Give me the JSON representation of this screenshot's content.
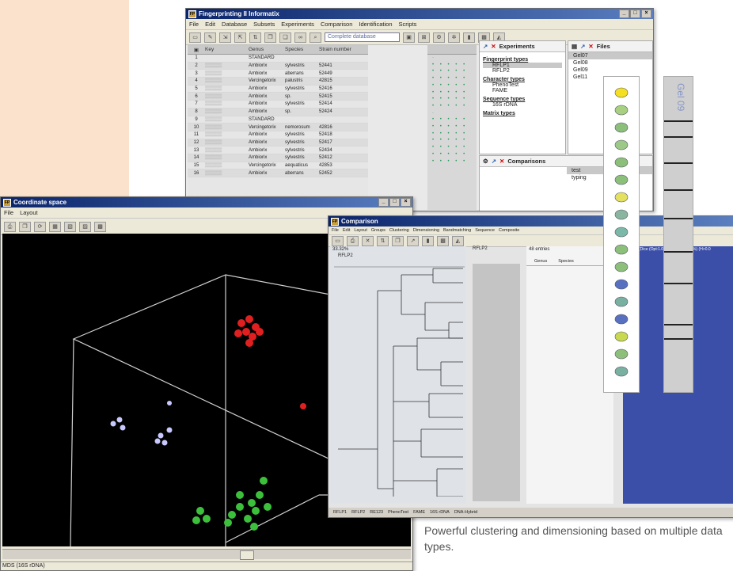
{
  "fp_window": {
    "title": "Fingerprinting II Informatix",
    "menu": [
      "File",
      "Edit",
      "Database",
      "Subsets",
      "Experiments",
      "Comparison",
      "Identification",
      "Scripts"
    ],
    "db_selector": "Complete database",
    "grid_headers": [
      "Key",
      "Genus",
      "Species",
      "Strain number"
    ],
    "rows": [
      {
        "n": "1",
        "key": "",
        "genus": "STANDARD",
        "species": "",
        "strain": ""
      },
      {
        "n": "2",
        "key": "",
        "genus": "Ambiorix",
        "species": "sylvestris",
        "strain": "52441"
      },
      {
        "n": "3",
        "key": "",
        "genus": "Ambiorix",
        "species": "aberrans",
        "strain": "52449"
      },
      {
        "n": "4",
        "key": "",
        "genus": "Vercingetorix",
        "species": "palustris",
        "strain": "42815"
      },
      {
        "n": "5",
        "key": "",
        "genus": "Ambiorix",
        "species": "sylvestris",
        "strain": "52416"
      },
      {
        "n": "6",
        "key": "",
        "genus": "Ambiorix",
        "species": "sp.",
        "strain": "52415"
      },
      {
        "n": "7",
        "key": "",
        "genus": "Ambiorix",
        "species": "sylvestris",
        "strain": "52414"
      },
      {
        "n": "8",
        "key": "",
        "genus": "Ambiorix",
        "species": "sp.",
        "strain": "52424"
      },
      {
        "n": "9",
        "key": "",
        "genus": "STANDARD",
        "species": "",
        "strain": ""
      },
      {
        "n": "10",
        "key": "",
        "genus": "Vercingetorix",
        "species": "nemorosum",
        "strain": "42816"
      },
      {
        "n": "11",
        "key": "",
        "genus": "Ambiorix",
        "species": "sylvestris",
        "strain": "52418"
      },
      {
        "n": "12",
        "key": "",
        "genus": "Ambiorix",
        "species": "sylvestris",
        "strain": "52417"
      },
      {
        "n": "13",
        "key": "",
        "genus": "Ambiorix",
        "species": "sylvestris",
        "strain": "52434"
      },
      {
        "n": "14",
        "key": "",
        "genus": "Ambiorix",
        "species": "sylvestris",
        "strain": "52412"
      },
      {
        "n": "15",
        "key": "",
        "genus": "Vercingetorix",
        "species": "aequaticus",
        "strain": "42853"
      },
      {
        "n": "16",
        "key": "",
        "genus": "Ambiorix",
        "species": "aberrans",
        "strain": "52452"
      }
    ],
    "experiments_title": "Experiments",
    "files_title": "Files",
    "experiment_tree": [
      {
        "cat": "Fingerprint types",
        "items": [
          "RFLP1",
          "RFLP2"
        ]
      },
      {
        "cat": "Character types",
        "items": [
          "PhenoTest",
          "FAME"
        ]
      },
      {
        "cat": "Sequence types",
        "items": [
          "16S rDNA"
        ]
      },
      {
        "cat": "Matrix types",
        "items": [
          ""
        ]
      }
    ],
    "files": [
      "Gel07",
      "Gel08",
      "Gel09",
      "Gel11"
    ],
    "comparisons_title": "Comparisons",
    "comparisons": [
      "test",
      "typing"
    ]
  },
  "coord_window": {
    "title": "Coordinate space",
    "menu": [
      "File",
      "Layout"
    ],
    "status": "MDS (16S rDNA)"
  },
  "comparison_window": {
    "title": "Comparison",
    "menu": [
      "File",
      "Edit",
      "Layout",
      "Groups",
      "Clustering",
      "Dimensioning",
      "Bandmatching",
      "Sequence",
      "Composite"
    ],
    "tree_label": "RFLP2",
    "gel_label": "RFLP2",
    "similarity": "33.32%",
    "entries": "48 entries",
    "list_headers": [
      "Genus",
      "Species"
    ],
    "matrix_header": "RFLP2 (Dice (Opt:1.0%) (Tol 1.0%-1.0%) (H>0.0",
    "tabs": [
      "RFLP1",
      "RFLP2",
      "RE123",
      "PhenoTest",
      "FAME",
      "16S rDNA",
      "DNA-Hybrid"
    ]
  },
  "caption": "Powerful clustering and dimensioning based on multiple data types.",
  "strip_label": "Gel 09"
}
